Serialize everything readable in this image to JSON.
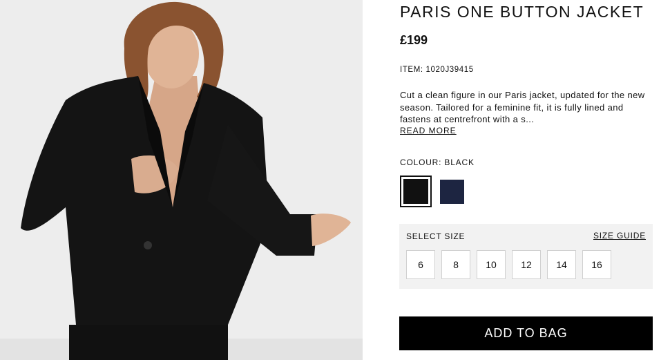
{
  "product": {
    "title": "PARIS ONE BUTTON JACKET",
    "price": "£199",
    "item": "ITEM: 1020J39415",
    "description": "Cut a clean figure in our Paris jacket, updated for the new season. Tailored for a feminine fit, it is fully lined and fastens at centrefront with a s...",
    "read_more": "READ MORE"
  },
  "colour": {
    "label": "COLOUR: BLACK",
    "swatches": [
      {
        "name": "black",
        "color": "#111111",
        "selected": true
      },
      {
        "name": "navy",
        "color": "#1d2541",
        "selected": false
      }
    ]
  },
  "size": {
    "label": "SELECT SIZE",
    "guide": "SIZE GUIDE",
    "options": [
      "6",
      "8",
      "10",
      "12",
      "14",
      "16"
    ]
  },
  "cta": {
    "add_to_bag": "ADD TO BAG"
  },
  "image": {
    "subject": "model wearing black one button jacket"
  }
}
